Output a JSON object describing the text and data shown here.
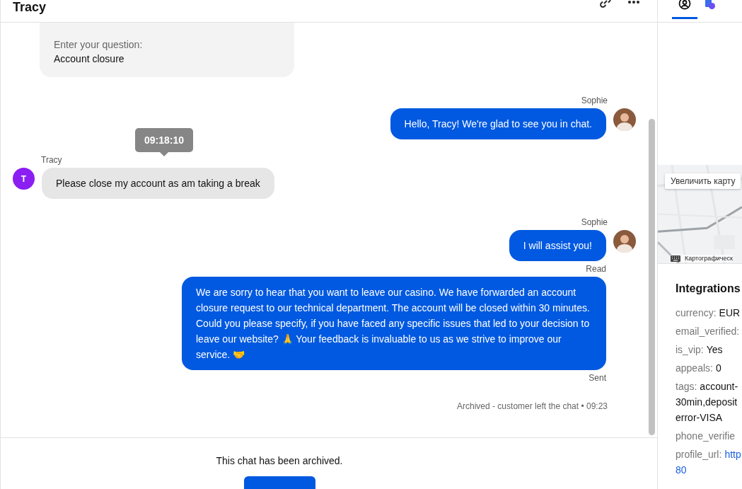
{
  "header": {
    "title": "Tracy"
  },
  "messages": [
    {
      "kind": "form",
      "label": "Enter your question:",
      "value": "Account closure"
    },
    {
      "kind": "agent",
      "author": "Sophie",
      "text": "Hello, Tracy! We're glad to see you in chat."
    },
    {
      "kind": "customer",
      "author": "Tracy",
      "initial": "T",
      "text": "Please close my account as am taking a break",
      "tooltip": "09:18:10"
    },
    {
      "kind": "agent",
      "author": "Sophie",
      "text": "I will assist you!",
      "status": "Read"
    },
    {
      "kind": "agent",
      "text": "We are sorry to hear that you want to leave our casino. We have forwarded an account closure request to our technical department. The account will be closed within 30 minutes. Could you please specify, if you have faced any specific issues that led to your decision to leave our website? 🙏 Your feedback is invaluable to us as we strive to improve our service. 🤝",
      "status": "Sent"
    }
  ],
  "status_line": {
    "text": "Archived - customer left the chat • 09:23"
  },
  "footer": {
    "notice": "This chat has been archived."
  },
  "panel_tabs": [
    {
      "kind": "profile",
      "selected": true
    },
    {
      "kind": "chat-doc",
      "selected": false
    }
  ],
  "map": {
    "enlarge_button": "Увеличить карту",
    "attribution": "Картографическ"
  },
  "integrations": {
    "title": "Integrations",
    "fields": [
      {
        "key": "currency:",
        "value": [
          "EUR"
        ]
      },
      {
        "key": "email_verified:"
      },
      {
        "key": "is_vip:",
        "value": [
          "Yes"
        ]
      },
      {
        "key": "appeals:",
        "value": [
          "0"
        ]
      },
      {
        "key": "tags:",
        "value": [
          "account-",
          "30min,deposit",
          "error-VISA"
        ]
      },
      {
        "key": "phone_verifie"
      },
      {
        "key": "profile_url:",
        "value": [
          "http",
          "80"
        ],
        "link": true
      }
    ]
  }
}
